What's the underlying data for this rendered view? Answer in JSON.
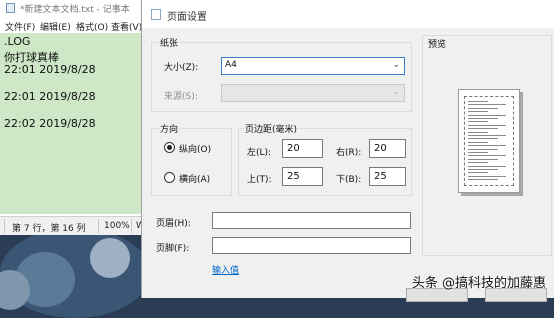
{
  "notepad": {
    "title": "*新建文本文档.txt - 记事本",
    "menu": [
      "文件(F)",
      "编辑(E)",
      "格式(O)",
      "查看(V)"
    ],
    "lines": [
      ".LOG",
      "你打球真棒",
      "22:01 2019/8/28",
      "",
      "22:01 2019/8/28",
      "",
      "22:02 2019/8/28"
    ],
    "status": {
      "position": "第 7 行，第 16 列",
      "zoom": "100%",
      "line_ending": "Wi"
    }
  },
  "dialog": {
    "title": "页面设置",
    "paper": {
      "group_label": "纸张",
      "size_label": "大小(Z):",
      "size_value": "A4",
      "source_label": "来源(S):",
      "source_value": ""
    },
    "orientation": {
      "group_label": "方向",
      "portrait_label": "纵向(O)",
      "landscape_label": "横向(A)",
      "selected": "portrait"
    },
    "margins": {
      "group_label": "页边距(毫米)",
      "left_label": "左(L):",
      "left_value": "20",
      "right_label": "右(R):",
      "right_value": "20",
      "top_label": "上(T):",
      "top_value": "25",
      "bottom_label": "下(B):",
      "bottom_value": "25"
    },
    "header_label": "页眉(H):",
    "header_value": "",
    "footer_label": "页脚(F):",
    "footer_value": "",
    "input_values_link": "输入值",
    "preview_label": "预览"
  },
  "watermark": "头条 @搞科技的加藤惠",
  "colors": {
    "notepad_text_bg": "#cde7c7",
    "link": "#0066cc",
    "active_border": "#3c7fc8"
  }
}
